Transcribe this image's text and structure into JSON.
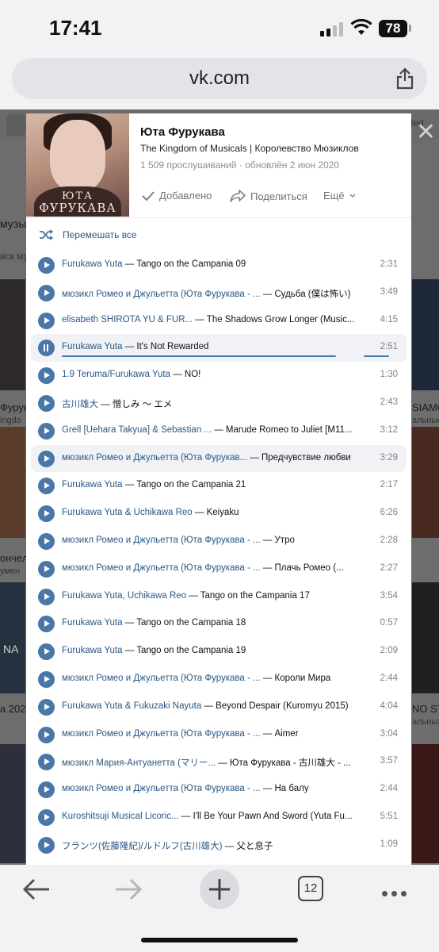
{
  "status": {
    "time": "17:41",
    "battery": "78"
  },
  "browser": {
    "url": "vk.com",
    "tabs_count": "12"
  },
  "playlist": {
    "cover_line1": "ЮТА",
    "cover_line2": "ФУРУКАВА",
    "title": "Юта Фурукава",
    "subtitle": "The Kingdom of Musicals | Королевство Мюзиклов",
    "meta": "1 509 прослушиваний · обновлён 2 июн 2020",
    "added_label": "Добавлено",
    "share_label": "Поделиться",
    "more_label": "Ещё",
    "shuffle_label": "Перемешать все"
  },
  "tracks": [
    {
      "artist": "Furukawa Yuta",
      "title": "Tango on the Campania 09",
      "duration": "2:31"
    },
    {
      "artist": "мюзикл Ромео и Джульетта (Юта Фурукава - ...",
      "title": "Судьба (僕は怖い)",
      "duration": "3:49"
    },
    {
      "artist": "elisabeth SHIROTA YU & FUR...",
      "title": "The Shadows Grow Longer (Music...",
      "duration": "4:15"
    },
    {
      "artist": "Furukawa Yuta",
      "title": "It's Not Rewarded",
      "duration": "2:51"
    },
    {
      "artist": "1.9 Teruma/Furukawa Yuta",
      "title": "NO!",
      "duration": "1:30"
    },
    {
      "artist": "古川雄大",
      "title": "憎しみ 〜 エメ",
      "duration": "2:43"
    },
    {
      "artist": "Grell [Uehara Takyua] & Sebastian ...",
      "title": "Marude Romeo to Juliet [M11...",
      "duration": "3:12"
    },
    {
      "artist": "мюзикл Ромео и Джульетта (Юта Фурукав...",
      "title": "Предчувствие любви",
      "duration": "3:29"
    },
    {
      "artist": "Furukawa Yuta",
      "title": "Tango on the Campania 21",
      "duration": "2:17"
    },
    {
      "artist": "Furukawa Yuta & Uchikawa Reo",
      "title": "Keiyaku",
      "duration": "6:26"
    },
    {
      "artist": "мюзикл Ромео и Джульетта (Юта Фурукава - ...",
      "title": "Утро",
      "duration": "2:28"
    },
    {
      "artist": "мюзикл Ромео и Джульетта (Юта Фурукава - ...",
      "title": "Плачь Ромео (...",
      "duration": "2:27"
    },
    {
      "artist": "Furukawa Yuta, Uchikawa Reo",
      "title": "Tango on the Campania 17",
      "duration": "3:54"
    },
    {
      "artist": "Furukawa Yuta",
      "title": "Tango on the Campania 18",
      "duration": "0:57"
    },
    {
      "artist": "Furukawa Yuta",
      "title": "Tango on the Campania 19",
      "duration": "2:09"
    },
    {
      "artist": "мюзикл Ромео и Джульетта (Юта Фурукава - ...",
      "title": "Короли Мира",
      "duration": "2:44"
    },
    {
      "artist": "Furukawa Yuta & Fukuzaki Nayuta",
      "title": "Beyond Despair (Kuromyu 2015)",
      "duration": "4:04"
    },
    {
      "artist": "мюзикл Ромео и Джульетта (Юта Фурукава - ...",
      "title": "Aimer",
      "duration": "3:04"
    },
    {
      "artist": "мюзикл Мария-Антуанетта (マリー...",
      "title": "Юта Фурукава - 古川雄大 - ...",
      "duration": "3:57"
    },
    {
      "artist": "мюзикл Ромео и Джульетта (Юта Фурукава - ...",
      "title": "На балу",
      "duration": "2:44"
    },
    {
      "artist": "Kuroshitsuji Musical Licoric...",
      "title": "I'll Be Your Pawn And Sword (Yuta Fu...",
      "duration": "5:51"
    },
    {
      "artist": "フランツ(佐藤隆紀)/ルドルフ(古川雄大)",
      "title": "父と息子",
      "duration": "1:09"
    }
  ],
  "background": {
    "musi": "музы",
    "search": "иск му",
    "furuk": "Фурук",
    "kingdo": "ingdo",
    "siamo": "SIAMO",
    "alnye": "альные",
    "ionchel": "ончел",
    "rumen": "умен",
    "na": "NA",
    "a202": "а 202",
    "nost": "NO ST",
    "alnyh": "альных",
    "rded": "arded"
  },
  "colors": {
    "accent": "#4a76a8",
    "link": "#2a5885",
    "muted": "#828282"
  }
}
